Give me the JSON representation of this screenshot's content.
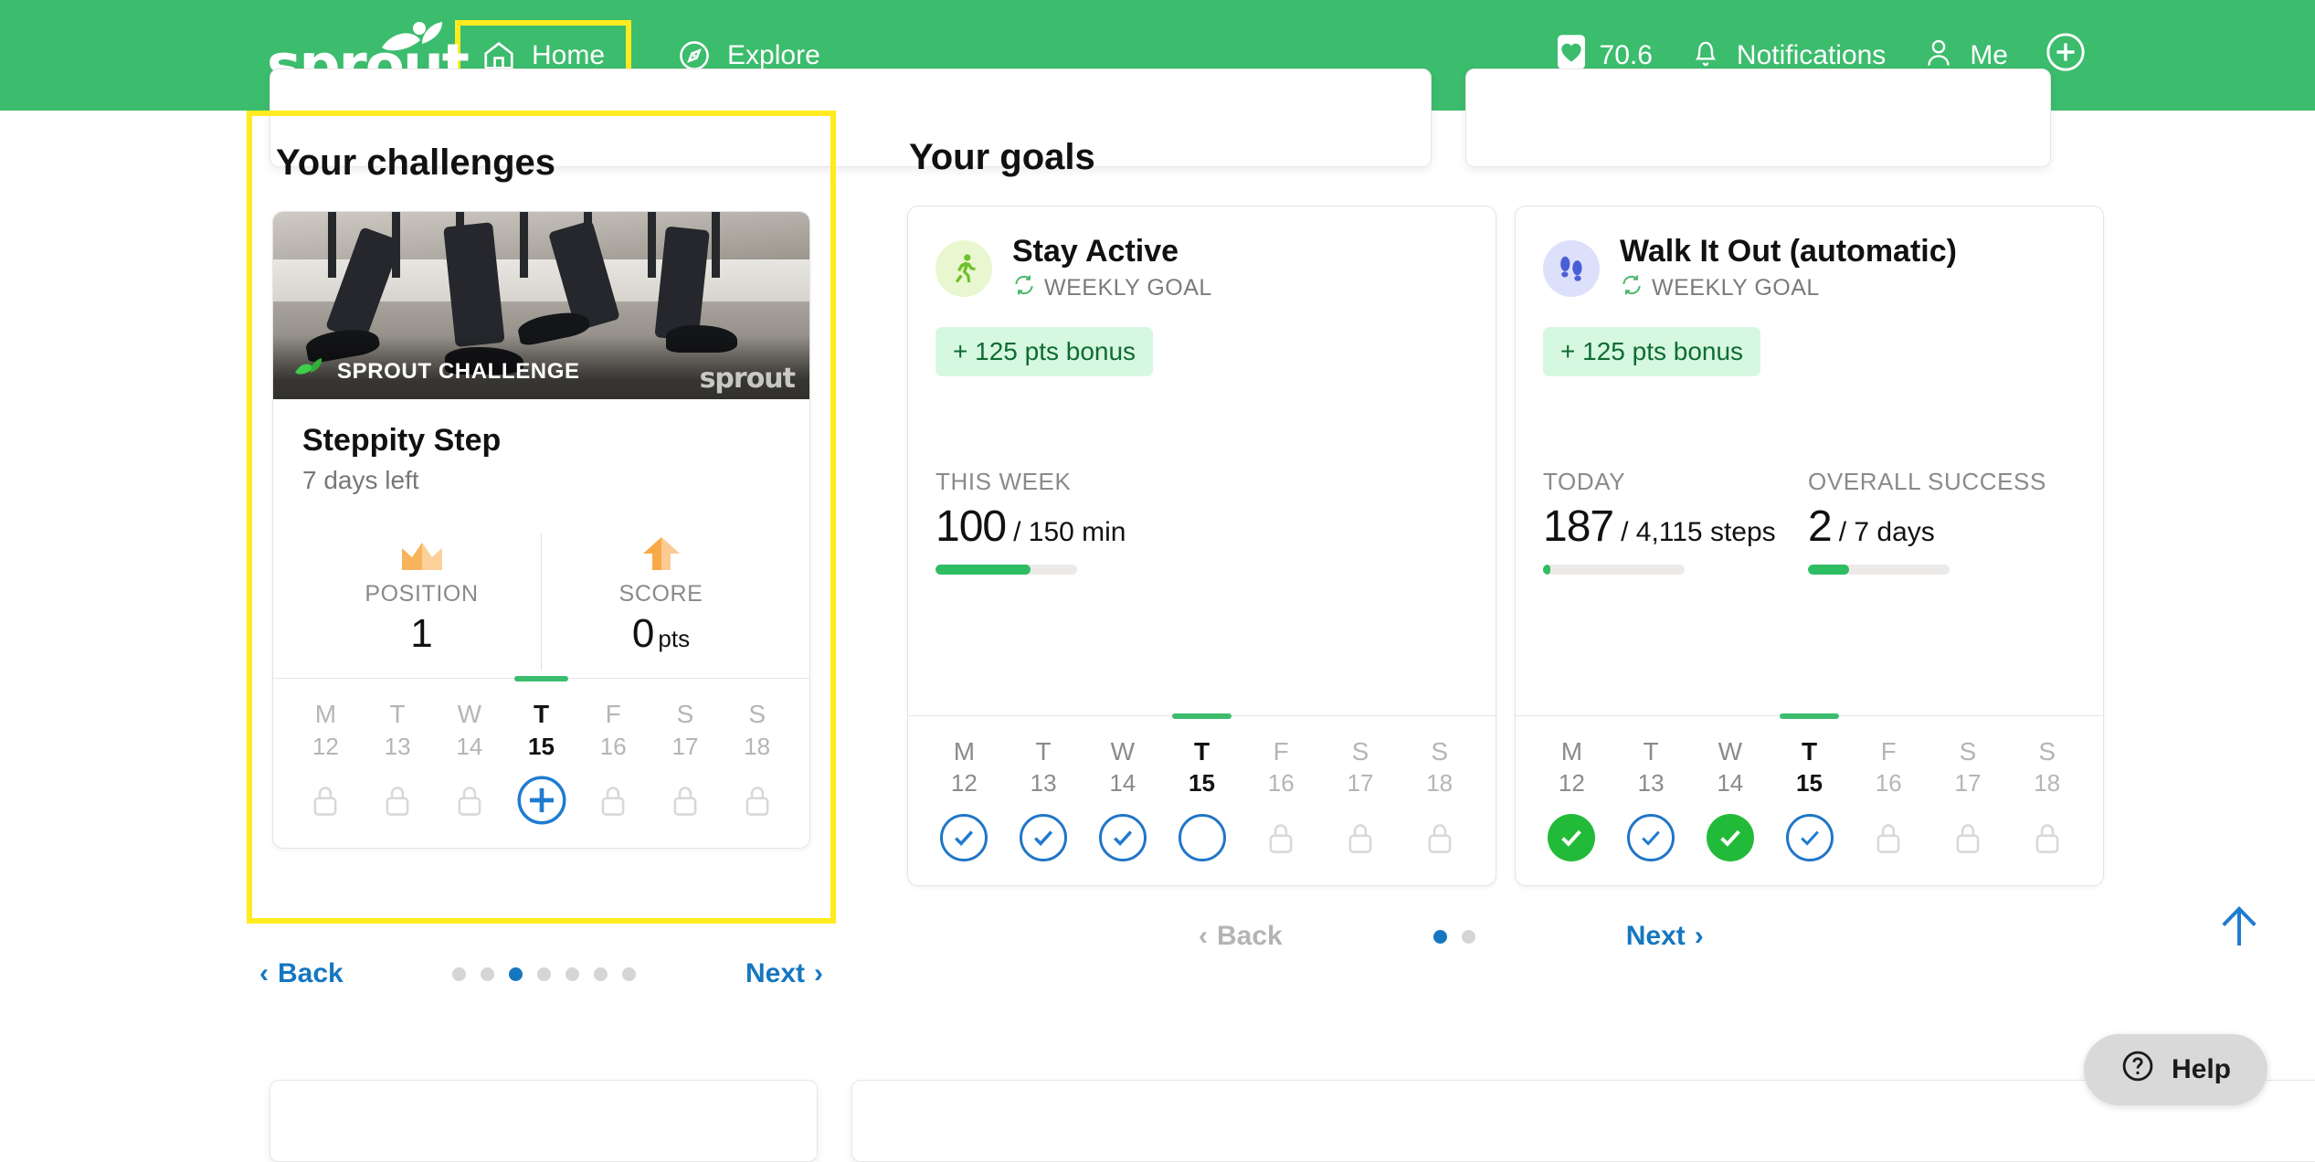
{
  "header": {
    "brand": "sprout",
    "nav": [
      {
        "label": "Home",
        "icon": "home-icon",
        "active": true
      },
      {
        "label": "Explore",
        "icon": "compass-icon",
        "active": false
      }
    ],
    "points": "70.6",
    "points_icon": "heart-card-icon",
    "notifications_label": "Notifications",
    "notifications_icon": "bell-icon",
    "me_label": "Me",
    "me_icon": "person-icon",
    "add_icon": "plus-circle-icon",
    "accent_green": "#3cbc6d",
    "highlight_yellow": "#ffeb1f"
  },
  "challenges": {
    "section_title": "Your challenges",
    "card": {
      "photo_badge": "SPROUT CHALLENGE",
      "photo_watermark": "sprout",
      "name": "Steppity Step",
      "days_left": "7 days left",
      "stats": [
        {
          "icon": "crown-icon",
          "label": "POSITION",
          "value": "1",
          "unit": ""
        },
        {
          "icon": "up-arrow-icon",
          "label": "SCORE",
          "value": "0",
          "unit": "pts"
        }
      ],
      "days": [
        {
          "dow": "M",
          "num": "12",
          "state": "locked",
          "mark": "lock-icon"
        },
        {
          "dow": "T",
          "num": "13",
          "state": "locked",
          "mark": "lock-icon"
        },
        {
          "dow": "W",
          "num": "14",
          "state": "locked",
          "mark": "lock-icon"
        },
        {
          "dow": "T",
          "num": "15",
          "state": "today",
          "mark": "plus-circle-icon"
        },
        {
          "dow": "F",
          "num": "16",
          "state": "locked",
          "mark": "lock-icon"
        },
        {
          "dow": "S",
          "num": "17",
          "state": "locked",
          "mark": "lock-icon"
        },
        {
          "dow": "S",
          "num": "18",
          "state": "locked",
          "mark": "lock-icon"
        }
      ]
    },
    "pager": {
      "back_label": "Back",
      "next_label": "Next",
      "back_disabled": false,
      "dot_count": 7,
      "active_dot": 3
    }
  },
  "goals": {
    "section_title": "Your goals",
    "cards": [
      {
        "avatar_icon": "runner-icon",
        "avatar_bg": "#e8f7cf",
        "title": "Stay Active",
        "kind_icon": "repeat-icon",
        "kind": "WEEKLY GOAL",
        "bonus": "+ 125 pts bonus",
        "metrics": [
          {
            "label": "THIS WEEK",
            "value": "100",
            "denominator": "/ 150 min",
            "progress_pct": 67
          }
        ],
        "days": [
          {
            "dow": "M",
            "num": "12",
            "state": "past",
            "mark": "check-outline-blue"
          },
          {
            "dow": "T",
            "num": "13",
            "state": "past",
            "mark": "check-outline-blue"
          },
          {
            "dow": "W",
            "num": "14",
            "state": "past",
            "mark": "check-outline-blue"
          },
          {
            "dow": "T",
            "num": "15",
            "state": "today",
            "mark": "circle-empty-blue"
          },
          {
            "dow": "F",
            "num": "16",
            "state": "locked",
            "mark": "lock-icon"
          },
          {
            "dow": "S",
            "num": "17",
            "state": "locked",
            "mark": "lock-icon"
          },
          {
            "dow": "S",
            "num": "18",
            "state": "locked",
            "mark": "lock-icon"
          }
        ]
      },
      {
        "avatar_icon": "footprints-icon",
        "avatar_bg": "#dde0fb",
        "title": "Walk It Out (automatic)",
        "kind_icon": "repeat-icon",
        "kind": "WEEKLY GOAL",
        "bonus": "+ 125 pts bonus",
        "metrics": [
          {
            "label": "TODAY",
            "value": "187",
            "denominator": "/ 4,115 steps",
            "progress_pct": 5
          },
          {
            "label": "OVERALL SUCCESS",
            "value": "2",
            "denominator": "/ 7 days",
            "progress_pct": 29
          }
        ],
        "days": [
          {
            "dow": "M",
            "num": "12",
            "state": "past",
            "mark": "check-filled-green"
          },
          {
            "dow": "T",
            "num": "13",
            "state": "past",
            "mark": "check-outline-blue"
          },
          {
            "dow": "W",
            "num": "14",
            "state": "past",
            "mark": "check-filled-green"
          },
          {
            "dow": "T",
            "num": "15",
            "state": "today",
            "mark": "check-outline-blue"
          },
          {
            "dow": "F",
            "num": "16",
            "state": "locked",
            "mark": "lock-icon"
          },
          {
            "dow": "S",
            "num": "17",
            "state": "locked",
            "mark": "lock-icon"
          },
          {
            "dow": "S",
            "num": "18",
            "state": "locked",
            "mark": "lock-icon"
          }
        ]
      }
    ],
    "pager": {
      "back_label": "Back",
      "next_label": "Next",
      "back_disabled": true,
      "dot_count": 2,
      "active_dot": 1
    }
  },
  "floating": {
    "scroll_top_icon": "arrow-up-icon",
    "help_label": "Help",
    "help_icon": "question-circle-icon"
  }
}
